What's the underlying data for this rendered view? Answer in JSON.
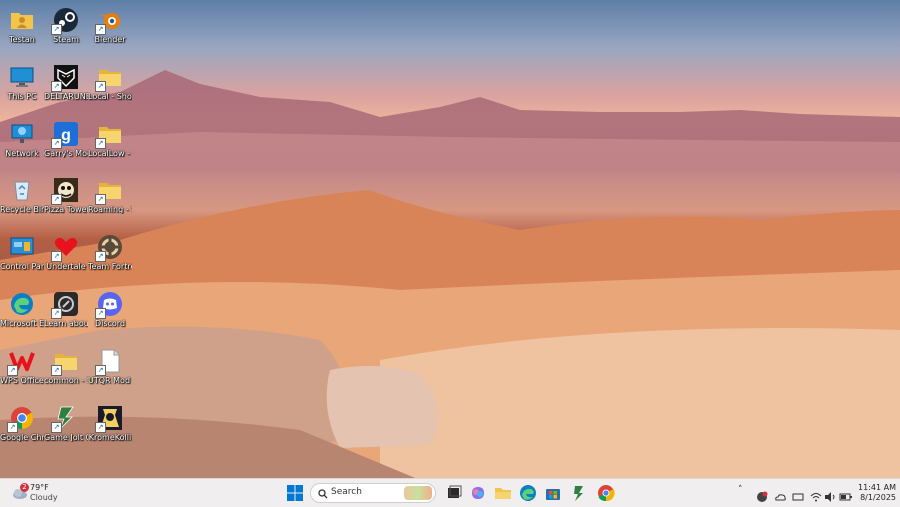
{
  "desktop_icons": [
    {
      "name": "testan",
      "label": "Testan",
      "col": 0,
      "row": 0,
      "kind": "user",
      "shortcut": false
    },
    {
      "name": "steam",
      "label": "Steam",
      "col": 1,
      "row": 0,
      "kind": "steam",
      "shortcut": true
    },
    {
      "name": "blender",
      "label": "Blender",
      "col": 2,
      "row": 0,
      "kind": "blender",
      "shortcut": true
    },
    {
      "name": "this-pc",
      "label": "This PC",
      "col": 0,
      "row": 1,
      "kind": "monitor",
      "shortcut": false
    },
    {
      "name": "deltarune",
      "label": "DELTARUNE",
      "col": 1,
      "row": 1,
      "kind": "deltarune",
      "shortcut": true
    },
    {
      "name": "local-shortcut",
      "label": "Local - Shortcut",
      "col": 2,
      "row": 1,
      "kind": "folder",
      "shortcut": true
    },
    {
      "name": "network",
      "label": "Network",
      "col": 0,
      "row": 2,
      "kind": "network",
      "shortcut": false
    },
    {
      "name": "garrys-mod",
      "label": "Garry's Mod",
      "col": 1,
      "row": 2,
      "kind": "gmod",
      "shortcut": true
    },
    {
      "name": "locallow-shortcut",
      "label": "LocalLow - Shortcut",
      "col": 2,
      "row": 2,
      "kind": "folder",
      "shortcut": true
    },
    {
      "name": "recycle-bin",
      "label": "Recycle Bin",
      "col": 0,
      "row": 3,
      "kind": "recycle",
      "shortcut": false
    },
    {
      "name": "pizza-tower",
      "label": "Pizza Tower",
      "col": 1,
      "row": 3,
      "kind": "pizza",
      "shortcut": true
    },
    {
      "name": "roaming-shortcut",
      "label": "Roaming - Shortcut",
      "col": 2,
      "row": 3,
      "kind": "folder",
      "shortcut": true
    },
    {
      "name": "control-panel",
      "label": "Control Panel",
      "col": 0,
      "row": 4,
      "kind": "control",
      "shortcut": false
    },
    {
      "name": "undertale",
      "label": "Undertale",
      "col": 1,
      "row": 4,
      "kind": "heart",
      "shortcut": true
    },
    {
      "name": "team-fortress",
      "label": "Team Fortress",
      "col": 2,
      "row": 4,
      "kind": "tf2",
      "shortcut": true
    },
    {
      "name": "microsoft-edge",
      "label": "Microsoft Edge",
      "col": 0,
      "row": 5,
      "kind": "edge",
      "shortcut": false
    },
    {
      "name": "learn-about-picture",
      "label": "Learn about this picture",
      "col": 1,
      "row": 5,
      "kind": "camera",
      "shortcut": true
    },
    {
      "name": "discord",
      "label": "Discord",
      "col": 2,
      "row": 5,
      "kind": "discord",
      "shortcut": true
    },
    {
      "name": "wps-office",
      "label": "WPS Office",
      "col": 0,
      "row": 6,
      "kind": "wps",
      "shortcut": true
    },
    {
      "name": "common-shortcut",
      "label": "common - Shortcut",
      "col": 1,
      "row": 6,
      "kind": "folder",
      "shortcut": true
    },
    {
      "name": "utqr-mod-manager",
      "label": "UTQR Mod Manager",
      "col": 2,
      "row": 6,
      "kind": "file",
      "shortcut": true
    },
    {
      "name": "google-chrome",
      "label": "Google Chrome",
      "col": 0,
      "row": 7,
      "kind": "chrome",
      "shortcut": true
    },
    {
      "name": "gamejolt-client",
      "label": "Game Jolt Client",
      "col": 1,
      "row": 7,
      "kind": "gamejolt",
      "shortcut": true
    },
    {
      "name": "kromekolli",
      "label": "KromeKolli",
      "col": 2,
      "row": 7,
      "kind": "krome",
      "shortcut": true
    }
  ],
  "taskbar": {
    "weather": {
      "temp": "79°F",
      "condition": "Cloudy",
      "badge": "2"
    },
    "search_placeholder": "Search",
    "clock": {
      "time": "11:41 AM",
      "date": "8/1/2025"
    }
  },
  "colors": {
    "taskbar": "#f0eeee",
    "folder": "#f3c44a",
    "accent": "#0067c0"
  }
}
